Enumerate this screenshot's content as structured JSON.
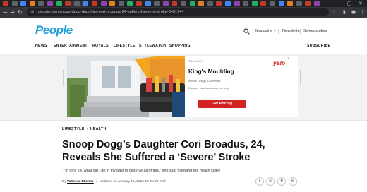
{
  "browser": {
    "url": "people.com/snoop-dogg-daughter-cori-broadus-24-suffered-severe-stroke-8431744",
    "tab_colors": [
      "#c0392b",
      "#5f6368",
      "#4285f4",
      "#e67e22",
      "#5f6368",
      "#8e44ad",
      "#27ae60",
      "#c0392b",
      "#5f6368",
      "#4285f4",
      "#c0392b",
      "#8e44ad",
      "#e67e22",
      "#5f6368",
      "#27ae60",
      "#c0392b",
      "#4285f4",
      "#5f6368",
      "#8e44ad",
      "#c0392b",
      "#5f6368",
      "#27ae60",
      "#e67e22",
      "#5f6368",
      "#c0392b",
      "#4285f4",
      "#8e44ad",
      "#5f6368",
      "#27ae60",
      "#c0392b",
      "#5f6368",
      "#4285f4",
      "#e67e22",
      "#5f6368",
      "#c0392b",
      "#8e44ad"
    ]
  },
  "site": {
    "logo": "People",
    "magazine": "Magazine",
    "newsletter": "Newsletter",
    "sweepstakes": "Sweepstakes",
    "nav": [
      "NEWS",
      "ENTERTAINMENT",
      "ROYALS",
      "LIFESTYLE",
      "STYLEWATCH",
      "SHOPPING"
    ],
    "subscribe": "SUBSCRIBE",
    "brand_color": "#1f9fd9"
  },
  "ad": {
    "side_label": "Advertisement",
    "meta": "Tokenet OH",
    "title": "King's Moulding",
    "line1": "Interior Design, Carpenters",
    "line2": "Discover local businesses on Yelp",
    "cta": "Get Pricing",
    "brand": "yelp",
    "accent": "#d32323"
  },
  "article": {
    "breadcrumb": [
      "LIFESTYLE",
      "HEALTH"
    ],
    "headline": "Snoop Dogg’s Daughter Cori Broadus, 24, Reveals She Suffered a ‘Severe’ Stroke",
    "dek": "\"I'm only 24, what did I do in my past to deserve all of this,\" she said following the health scare",
    "by": "By",
    "author": "Vanessa Etienne",
    "updated": "Updated on January 18, 2024 11:25AM EST"
  },
  "share_icons": [
    "facebook-icon",
    "x-icon",
    "pinterest-icon",
    "email-icon"
  ]
}
